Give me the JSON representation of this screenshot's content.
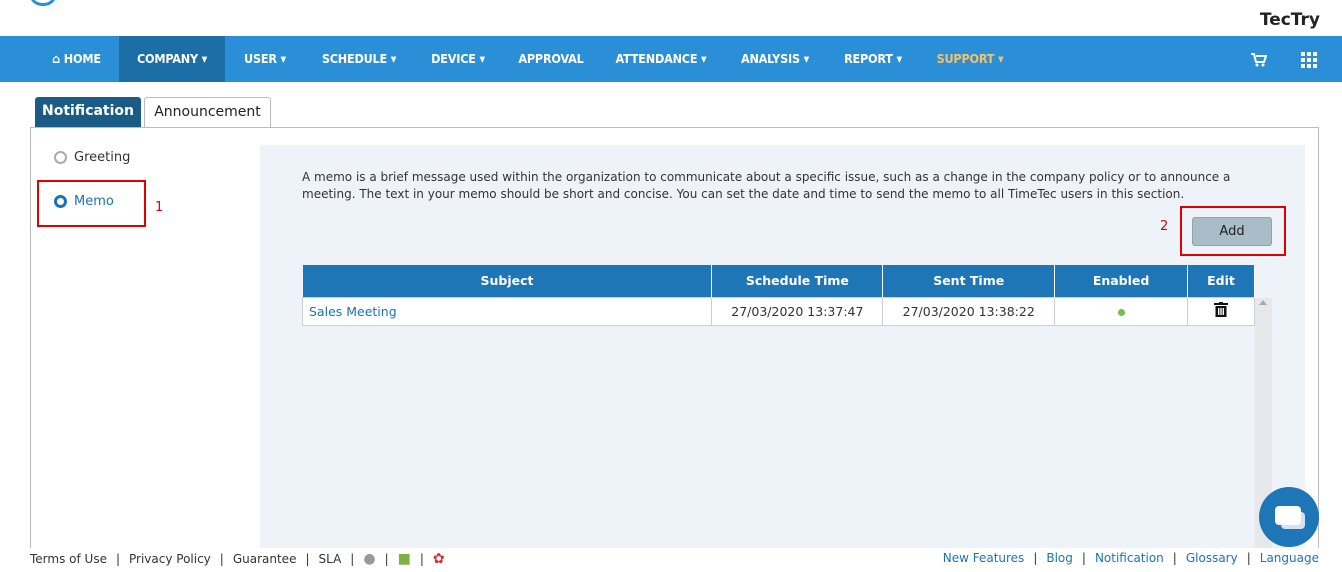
{
  "header": {
    "company": "TecTry"
  },
  "nav": {
    "items": [
      {
        "label": "HOME"
      },
      {
        "label": "COMPANY ▾"
      },
      {
        "label": "USER ▾"
      },
      {
        "label": "SCHEDULE ▾"
      },
      {
        "label": "DEVICE ▾"
      },
      {
        "label": "APPROVAL"
      },
      {
        "label": "ATTENDANCE ▾"
      },
      {
        "label": "ANALYSIS ▾"
      },
      {
        "label": "REPORT ▾"
      },
      {
        "label": "SUPPORT ▾"
      }
    ],
    "home_icon": "home-icon",
    "cart_icon": "cart-icon",
    "grid_icon": "grid-icon"
  },
  "tabs": {
    "notification": "Notification",
    "announcement": "Announcement"
  },
  "sidebar": {
    "greeting": "Greeting",
    "memo": "Memo"
  },
  "annotations": {
    "one": "1",
    "two": "2"
  },
  "content": {
    "description": "A memo is a brief message used within the organization to communicate about a specific issue, such as a change in the company policy or to announce a meeting. The text in your memo should be short and concise. You can set the date and time to send the memo to all TimeTec users in this section.",
    "add_label": "Add"
  },
  "table": {
    "headers": [
      "Subject",
      "Schedule Time",
      "Sent Time",
      "Enabled",
      "Edit"
    ],
    "rows": [
      {
        "subject": "Sales Meeting",
        "schedule_time": "27/03/2020 13:37:47",
        "sent_time": "27/03/2020 13:38:22",
        "enabled": true
      }
    ]
  },
  "footer": {
    "left": [
      "Terms of Use",
      "Privacy Policy",
      "Guarantee",
      "SLA"
    ],
    "right": [
      "New Features",
      "Blog",
      "Notification",
      "Glossary",
      "Language"
    ],
    "colors": {
      "accent": "#2a8fd6",
      "support": "#f3c26b",
      "annotation": "#e00000"
    }
  }
}
